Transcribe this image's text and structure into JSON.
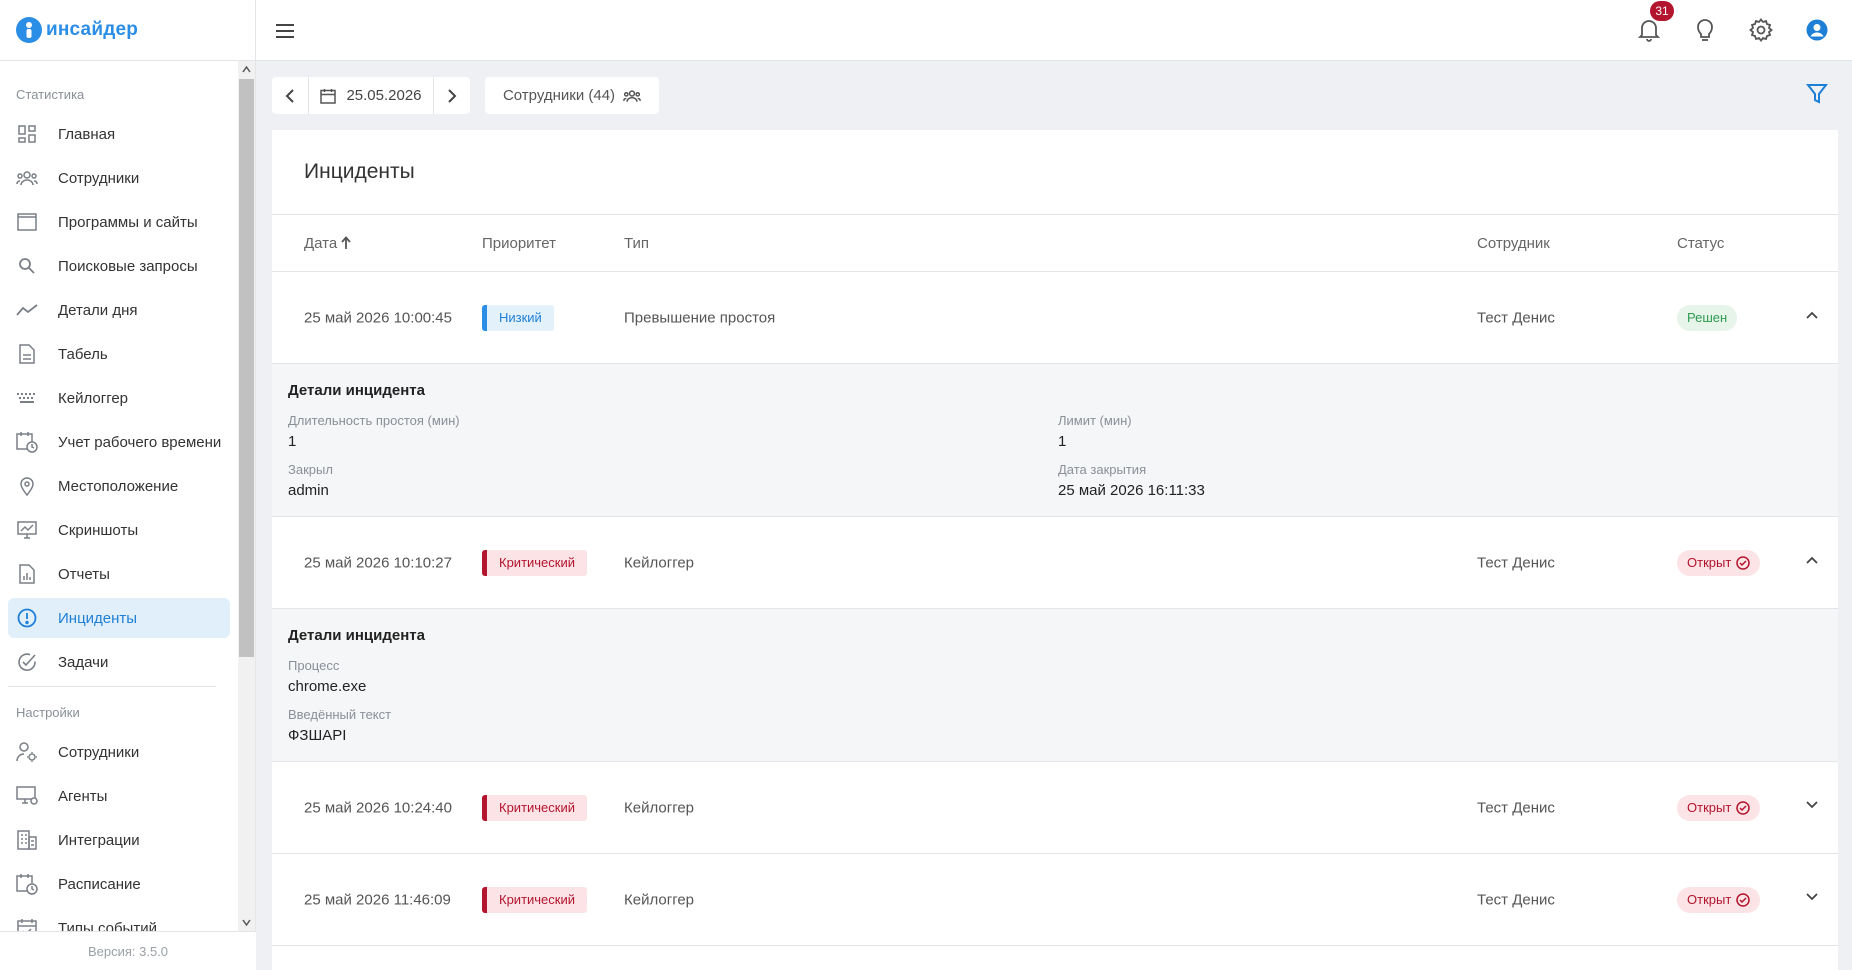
{
  "app": {
    "logo_text": "инсайдер",
    "version": "Версия: 3.5.0"
  },
  "sidebar": {
    "section_stats": "Статистика",
    "stats_items": [
      {
        "label": "Главная",
        "icon": "dashboard-icon"
      },
      {
        "label": "Сотрудники",
        "icon": "people-icon"
      },
      {
        "label": "Программы и сайты",
        "icon": "window-icon"
      },
      {
        "label": "Поисковые запросы",
        "icon": "search-icon"
      },
      {
        "label": "Детали дня",
        "icon": "trend-icon"
      },
      {
        "label": "Табель",
        "icon": "document-icon"
      },
      {
        "label": "Кейлоггер",
        "icon": "keyboard-icon"
      },
      {
        "label": "Учет рабочего времени",
        "icon": "calendar-clock-icon"
      },
      {
        "label": "Местоположение",
        "icon": "location-icon"
      },
      {
        "label": "Скриншоты",
        "icon": "screenshot-icon"
      },
      {
        "label": "Отчеты",
        "icon": "report-icon"
      },
      {
        "label": "Инциденты",
        "icon": "alert-icon"
      },
      {
        "label": "Задачи",
        "icon": "check-circle-icon"
      }
    ],
    "section_settings": "Настройки",
    "settings_items": [
      {
        "label": "Сотрудники",
        "icon": "user-settings-icon"
      },
      {
        "label": "Агенты",
        "icon": "monitor-settings-icon"
      },
      {
        "label": "Интеграции",
        "icon": "building-icon"
      },
      {
        "label": "Расписание",
        "icon": "calendar-clock-icon"
      },
      {
        "label": "Типы событий",
        "icon": "calendar-check-icon"
      }
    ],
    "active": "Инциденты"
  },
  "topbar": {
    "notification_count": "31"
  },
  "toolbar": {
    "date": "25.05.2026",
    "employees_label": "Сотрудники (44)"
  },
  "card": {
    "title": "Инциденты",
    "columns": {
      "date": "Дата",
      "priority": "Приоритет",
      "type": "Тип",
      "employee": "Сотрудник",
      "status": "Статус"
    },
    "rows": [
      {
        "date": "25 май 2026 10:00:45",
        "priority": "Низкий",
        "type": "Превышение простоя",
        "employee": "Тест Денис",
        "status": "Решен",
        "details": {
          "title": "Детали инцидента",
          "fields": [
            {
              "label": "Длительность простоя (мин)",
              "value": "1"
            },
            {
              "label": "Лимит (мин)",
              "value": "1"
            },
            {
              "label": "Закрыл",
              "value": "admin"
            },
            {
              "label": "Дата закрытия",
              "value": "25 май 2026 16:11:33"
            }
          ]
        }
      },
      {
        "date": "25 май 2026 10:10:27",
        "priority": "Критический",
        "type": "Кейлоггер",
        "employee": "Тест Денис",
        "status": "Открыт",
        "details": {
          "title": "Детали инцидента",
          "fields": [
            {
              "label": "Процесс",
              "value": "chrome.exe"
            },
            {
              "label": "Введённый текст",
              "value": "ФЗШАРI"
            }
          ]
        }
      },
      {
        "date": "25 май 2026 10:24:40",
        "priority": "Критический",
        "type": "Кейлоггер",
        "employee": "Тест Денис",
        "status": "Открыт"
      },
      {
        "date": "25 май 2026 11:46:09",
        "priority": "Критический",
        "type": "Кейлоггер",
        "employee": "Тест Денис",
        "status": "Открыт"
      }
    ]
  },
  "colors": {
    "accent": "#1e7fd6",
    "critical": "#b3142e",
    "resolved": "#2e9b50"
  }
}
